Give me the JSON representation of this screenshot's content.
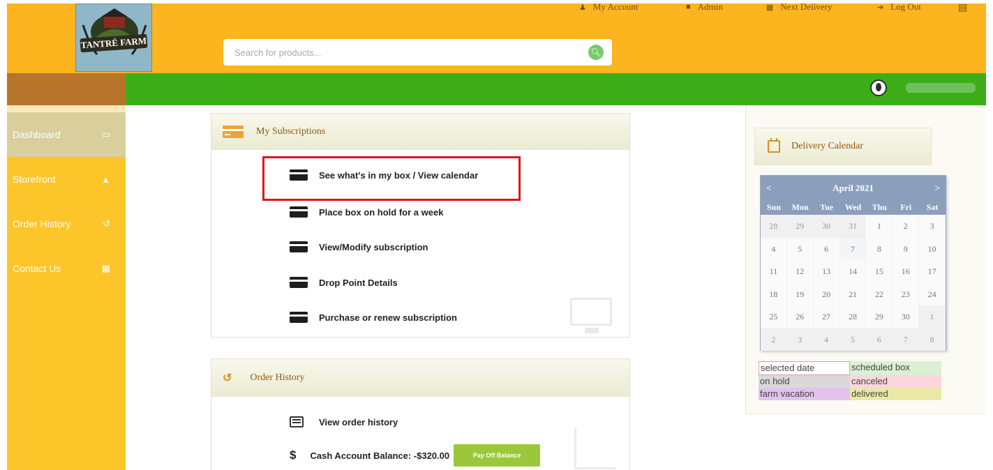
{
  "header": {
    "logo_text": "TANTRÉ FARM",
    "search_placeholder": "Search for products...",
    "nav": [
      {
        "label": "My Account",
        "icon": "user-icon"
      },
      {
        "label": "Admin",
        "icon": "shield-icon"
      },
      {
        "label": "Next Delivery",
        "icon": "calendar-icon"
      },
      {
        "label": "Log Out",
        "icon": "logout-icon"
      }
    ],
    "cart_icon": "cart-icon"
  },
  "sidebar": {
    "items": [
      {
        "label": "Dashboard",
        "icon": "monitor-icon",
        "active": true
      },
      {
        "label": "Storefront",
        "icon": "bag-icon"
      },
      {
        "label": "Order History",
        "icon": "history-icon"
      },
      {
        "label": "Contact Us",
        "icon": "chat-icon"
      }
    ]
  },
  "subscriptions": {
    "title": "My Subscriptions",
    "links": [
      "See what's in my box / View calendar",
      "Place box on hold for a week",
      "View/Modify subscription",
      "Drop Point Details",
      "Purchase or renew subscription"
    ]
  },
  "order_history": {
    "title": "Order History",
    "view_link": "View order history",
    "balance_text": "Cash Account Balance: -$320.00",
    "pay_button": "Pay Off Balance"
  },
  "calendar": {
    "title": "Delivery Calendar",
    "month": "April 2021",
    "prev": "<",
    "next": ">",
    "days_of_week": [
      "Sun",
      "Mon",
      "Tue",
      "Wed",
      "Thu",
      "Fri",
      "Sat"
    ],
    "weeks": [
      [
        "28",
        "29",
        "30",
        "31",
        "1",
        "2",
        "3"
      ],
      [
        "4",
        "5",
        "6",
        "7",
        "8",
        "9",
        "10"
      ],
      [
        "11",
        "12",
        "13",
        "14",
        "15",
        "16",
        "17"
      ],
      [
        "18",
        "19",
        "20",
        "21",
        "22",
        "23",
        "24"
      ],
      [
        "25",
        "26",
        "27",
        "28",
        "29",
        "30",
        "1"
      ],
      [
        "2",
        "3",
        "4",
        "5",
        "6",
        "7",
        "8"
      ]
    ],
    "legend": [
      {
        "label": "selected date",
        "color": "#ffffff"
      },
      {
        "label": "scheduled box",
        "color": "#d9f0d2"
      },
      {
        "label": "on hold",
        "color": "#d9d9d9"
      },
      {
        "label": "canceled",
        "color": "#fbd5dc"
      },
      {
        "label": "farm vacation",
        "color": "#e2c3ec"
      },
      {
        "label": "delivered",
        "color": "#eaeaa6"
      }
    ]
  }
}
